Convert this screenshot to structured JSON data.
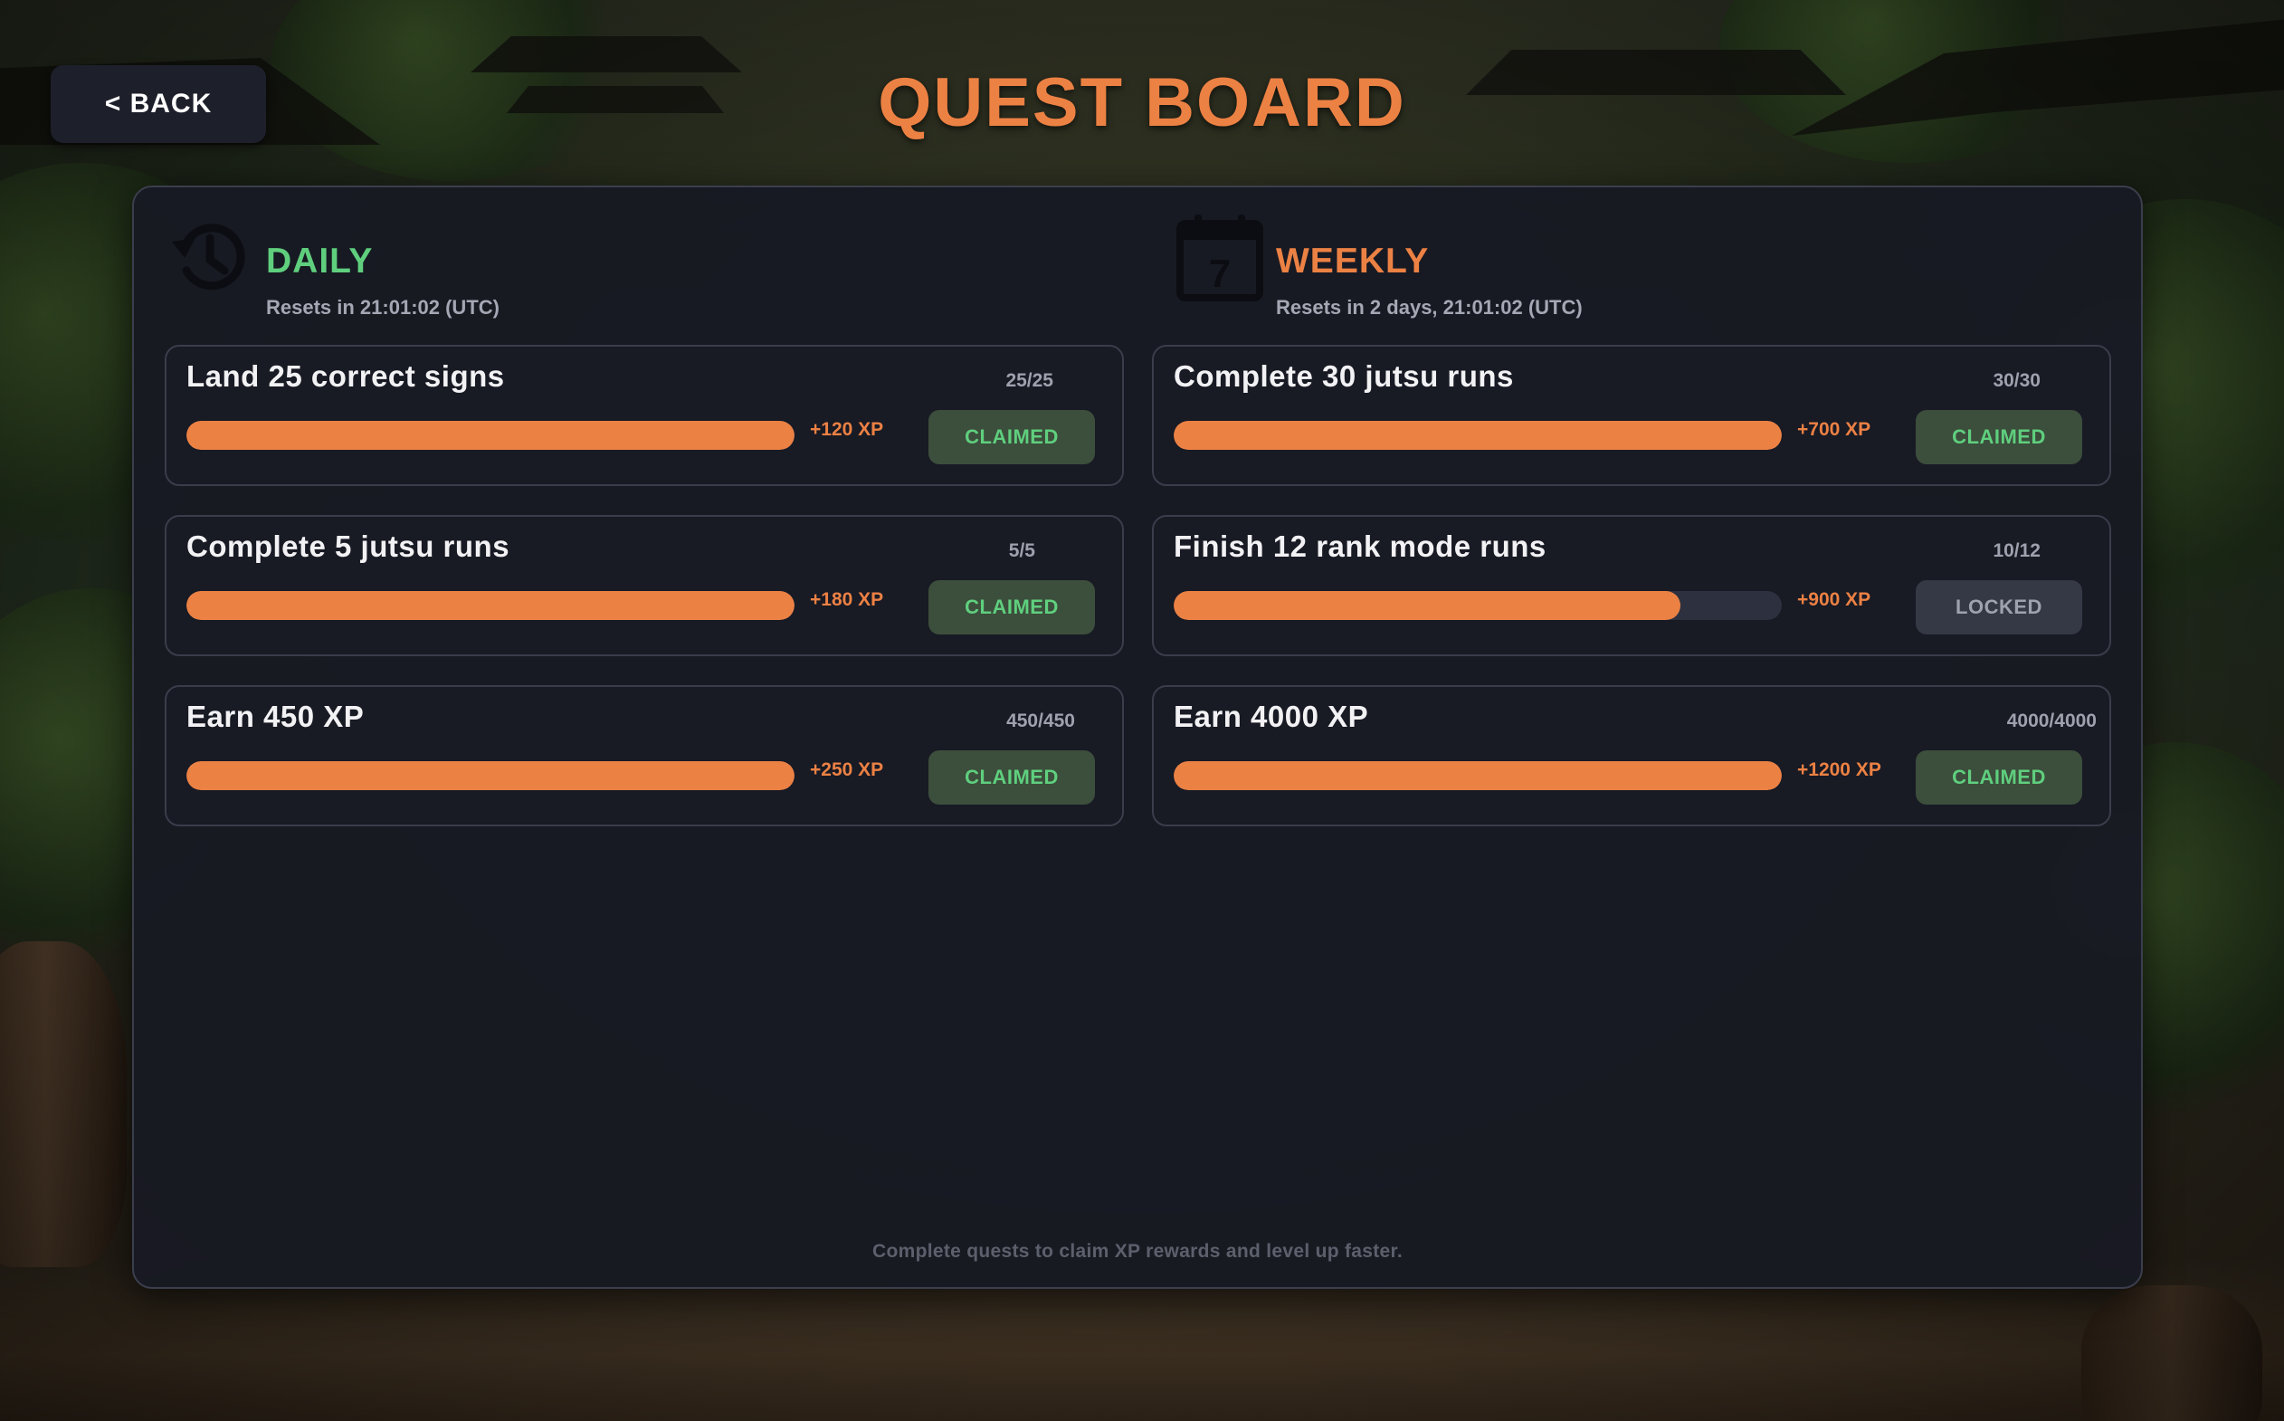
{
  "header": {
    "back_label": "< BACK",
    "title": "QUEST BOARD"
  },
  "daily": {
    "title": "DAILY",
    "reset": "Resets in 21:01:02 (UTC)",
    "title_color": "#5fcf7e",
    "quests": [
      {
        "name": "Land 25 correct signs",
        "progress": "25/25",
        "fraction": 1.0,
        "reward": "+120 XP",
        "status": "CLAIMED"
      },
      {
        "name": "Complete 5 jutsu runs",
        "progress": "5/5",
        "fraction": 1.0,
        "reward": "+180 XP",
        "status": "CLAIMED"
      },
      {
        "name": "Earn 450 XP",
        "progress": "450/450",
        "fraction": 1.0,
        "reward": "+250 XP",
        "status": "CLAIMED"
      }
    ]
  },
  "weekly": {
    "title": "WEEKLY",
    "reset": "Resets in 2 days, 21:01:02 (UTC)",
    "title_color": "#ec8144",
    "calendar_day": "7",
    "quests": [
      {
        "name": "Complete 30 jutsu runs",
        "progress": "30/30",
        "fraction": 1.0,
        "reward": "+700 XP",
        "status": "CLAIMED"
      },
      {
        "name": "Finish 12 rank mode runs",
        "progress": "10/12",
        "fraction": 0.8333,
        "reward": "+900 XP",
        "status": "LOCKED"
      },
      {
        "name": "Earn 4000 XP",
        "progress": "4000/4000",
        "fraction": 1.0,
        "reward": "+1200 XP",
        "status": "CLAIMED"
      }
    ]
  },
  "footer": {
    "text": "Complete quests to claim XP rewards and level up faster."
  },
  "colors": {
    "accent": "#ec8144",
    "claimed_text": "#5fcf7e",
    "panel": "#181a23"
  }
}
